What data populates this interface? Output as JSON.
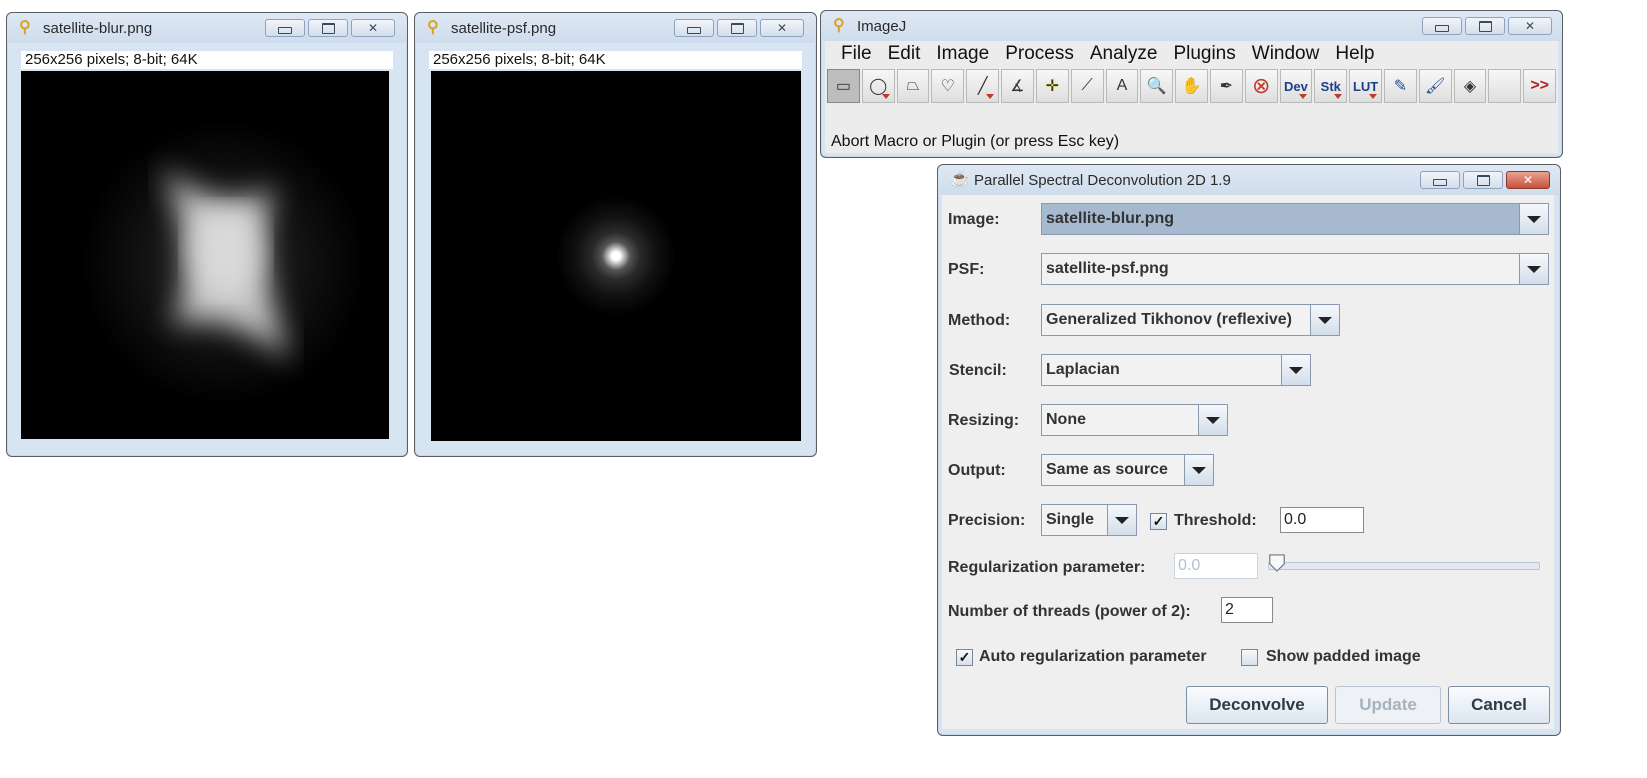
{
  "windows": {
    "blur": {
      "title": "satellite-blur.png",
      "info": "256x256 pixels; 8-bit; 64K"
    },
    "psf": {
      "title": "satellite-psf.png",
      "info": "256x256 pixels; 8-bit; 64K"
    },
    "imagej": {
      "title": "ImageJ",
      "menu": [
        "File",
        "Edit",
        "Image",
        "Process",
        "Analyze",
        "Plugins",
        "Window",
        "Help"
      ],
      "tools": [
        {
          "name": "rectangle-tool-icon",
          "glyph": "▭",
          "active": true,
          "dropdown": false
        },
        {
          "name": "oval-tool-icon",
          "glyph": "◯",
          "active": false,
          "dropdown": true
        },
        {
          "name": "polygon-tool-icon",
          "glyph": "⏢",
          "active": false,
          "dropdown": false
        },
        {
          "name": "freehand-tool-icon",
          "glyph": "♡",
          "active": false,
          "dropdown": false
        },
        {
          "name": "line-tool-icon",
          "glyph": "╱",
          "active": false,
          "dropdown": true
        },
        {
          "name": "angle-tool-icon",
          "glyph": "∡",
          "active": false,
          "dropdown": false
        },
        {
          "name": "point-tool-icon",
          "glyph": "✛",
          "active": false,
          "dropdown": false
        },
        {
          "name": "wand-tool-icon",
          "glyph": "⟋",
          "active": false,
          "dropdown": false
        },
        {
          "name": "text-tool-icon",
          "glyph": "A",
          "active": false,
          "dropdown": false
        },
        {
          "name": "magnifier-tool-icon",
          "glyph": "🔍",
          "active": false,
          "dropdown": false
        },
        {
          "name": "hand-tool-icon",
          "glyph": "✋",
          "active": false,
          "dropdown": false
        },
        {
          "name": "dropper-tool-icon",
          "glyph": "✒",
          "active": false,
          "dropdown": false
        },
        {
          "name": "abort-icon",
          "glyph": "⊗",
          "active": false,
          "dropdown": false
        },
        {
          "name": "dev-menu-icon",
          "glyph": "Dev",
          "active": false,
          "dropdown": true
        },
        {
          "name": "stk-menu-icon",
          "glyph": "Stk",
          "active": false,
          "dropdown": true
        },
        {
          "name": "lut-menu-icon",
          "glyph": "LUT",
          "active": false,
          "dropdown": true
        },
        {
          "name": "pencil-tool-icon",
          "glyph": "✎",
          "active": false,
          "dropdown": false
        },
        {
          "name": "brush-tool-icon",
          "glyph": "🖌",
          "active": false,
          "dropdown": false
        },
        {
          "name": "flood-fill-tool-icon",
          "glyph": "◈",
          "active": false,
          "dropdown": false
        },
        {
          "name": "empty-tool-slot",
          "glyph": "",
          "active": false,
          "dropdown": false
        },
        {
          "name": "more-tools-icon",
          "glyph": ">>",
          "active": false,
          "dropdown": false
        }
      ],
      "status": "Abort Macro or Plugin (or press Esc key)"
    },
    "dialog": {
      "title": "Parallel Spectral Deconvolution 2D 1.9",
      "image_label": "Image:",
      "image_value": "satellite-blur.png",
      "psf_label": "PSF:",
      "psf_value": "satellite-psf.png",
      "method_label": "Method:",
      "method_value": "Generalized Tikhonov (reflexive)",
      "stencil_label": "Stencil:",
      "stencil_value": "Laplacian",
      "resizing_label": "Resizing:",
      "resizing_value": "None",
      "output_label": "Output:",
      "output_value": "Same as source",
      "precision_label": "Precision:",
      "precision_value": "Single",
      "threshold_checked": true,
      "threshold_check_glyph": "✓",
      "threshold_label": "Threshold:",
      "threshold_value": "0.0",
      "regularization_label": "Regularization parameter:",
      "regularization_value": "0.0",
      "regularization_slider_fraction": 0.0,
      "threads_label": "Number of threads (power of 2):",
      "threads_value": "2",
      "auto_reg_checked": true,
      "auto_reg_label": "Auto regularization parameter",
      "show_padded_checked": false,
      "show_padded_label": "Show padded image",
      "deconvolve_label": "Deconvolve",
      "update_label": "Update",
      "cancel_label": "Cancel"
    }
  },
  "colors": {
    "title_icon": "#d9a323",
    "close_active": "#c8503a",
    "lut_dev_text": "#1f3e8a",
    "more_tools": "#b22222"
  }
}
